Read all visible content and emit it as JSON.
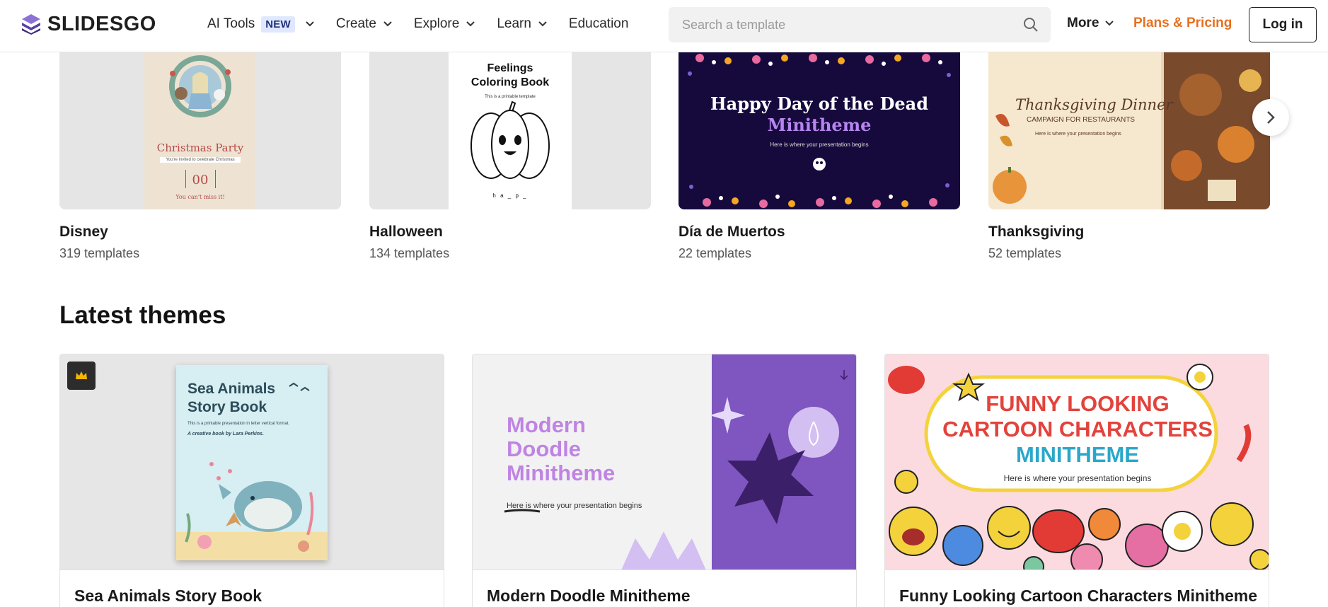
{
  "header": {
    "logo_text": "SLIDESGO",
    "nav": {
      "ai_tools": "AI Tools",
      "new_badge": "NEW",
      "create": "Create",
      "explore": "Explore",
      "learn": "Learn",
      "education": "Education"
    },
    "search_placeholder": "Search a template",
    "more": "More",
    "pricing": "Plans & Pricing",
    "login": "Log in"
  },
  "categories": [
    {
      "title": "Disney",
      "count": "319 templates",
      "thumb": {
        "heading": "Christmas Party",
        "sub": "You're invited to celebrate Christmas",
        "date": "00",
        "footer": "You can't miss it!"
      }
    },
    {
      "title": "Halloween",
      "count": "134 templates",
      "thumb": {
        "heading_line1": "Feelings",
        "heading_line2": "Coloring Book",
        "sub": "This is a printable template",
        "word": "h a _ p _"
      }
    },
    {
      "title": "Día de Muertos",
      "count": "22 templates",
      "thumb": {
        "heading_line1": "Happy Day of the Dead",
        "heading_line2": "Minitheme",
        "sub": "Here is where your presentation begins"
      }
    },
    {
      "title": "Thanksgiving",
      "count": "52 templates",
      "thumb": {
        "heading": "Thanksgiving Dinner",
        "sub": "CAMPAIGN FOR RESTAURANTS",
        "sub2": "Here is where your presentation begins"
      }
    }
  ],
  "latest": {
    "section_title": "Latest themes",
    "themes": [
      {
        "title": "Sea Animals Story Book",
        "thumb": {
          "heading_line1": "Sea Animals",
          "heading_line2": "Story Book",
          "sub": "This is a printable presentation in letter vertical format.",
          "author": "A creative book by Lara Perkins."
        }
      },
      {
        "title": "Modern Doodle Minitheme",
        "thumb": {
          "heading_line1": "Modern",
          "heading_line2": "Doodle",
          "heading_line3": "Minitheme",
          "sub": "Here is where your presentation begins"
        }
      },
      {
        "title": "Funny Looking Cartoon Characters Minitheme",
        "thumb": {
          "heading_line1": "FUNNY LOOKING",
          "heading_line2": "CARTOON CHARACTERS",
          "heading_line3": "MINITHEME",
          "sub": "Here is where your presentation begins"
        }
      }
    ]
  },
  "colors": {
    "accent": "#e8701f",
    "badge_bg": "#dfe8ff",
    "badge_text": "#1e2f7a",
    "logo_purple": "#6a4fb3"
  },
  "icons": [
    "slidesgo-logo-icon",
    "chevron-down-icon",
    "search-icon",
    "chevron-right-icon",
    "crown-icon",
    "download-arrow-icon"
  ]
}
